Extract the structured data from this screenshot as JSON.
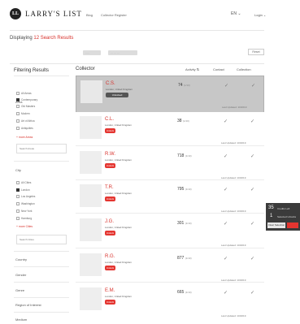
{
  "header": {
    "logo_mark": "LL",
    "logo_text": "LARRY'S LIST",
    "nav": [
      "Blog",
      "Collector Register"
    ],
    "lang": "EN",
    "login": "Login"
  },
  "results": {
    "prefix": "Displaying",
    "count_text": "12 Search Results"
  },
  "filters": {
    "pills": [
      "·····",
      "··· ··· ···"
    ],
    "reset_label": "Reset"
  },
  "sidebar": {
    "title": "Filtering Results",
    "area": {
      "head": "Area",
      "options": [
        {
          "label": "All Areas",
          "checked": false
        },
        {
          "label": "Contemporary",
          "checked": true
        },
        {
          "label": "Old Masters",
          "checked": false
        },
        {
          "label": "Modern",
          "checked": false
        },
        {
          "label": "Art of Africa",
          "checked": false
        },
        {
          "label": "Antiquities",
          "checked": false
        }
      ],
      "more": "+ more Areas",
      "input_placeholder": "Search Areas"
    },
    "city": {
      "head": "City",
      "options": [
        {
          "label": "All Cities",
          "checked": false
        },
        {
          "label": "London",
          "checked": true
        },
        {
          "label": "Los Angeles",
          "checked": false
        },
        {
          "label": "Washington",
          "checked": false
        },
        {
          "label": "New York",
          "checked": false
        },
        {
          "label": "Hamburg",
          "checked": false
        }
      ],
      "more": "+ more Cities",
      "input_placeholder": "Search Cities"
    },
    "sections": [
      "Country",
      "Gender",
      "Genre",
      "Region of Interest",
      "Medium"
    ]
  },
  "table": {
    "headers": {
      "collector": "Collector",
      "activity": "Activity",
      "col3": "Contact",
      "col4": "Collection"
    },
    "rows": [
      {
        "name": "C.S.",
        "location": "London, United Kingdom",
        "button": "Unlocked",
        "activity": "74",
        "activity_unit": "(1/10)",
        "updated": "Last Updated: 10/2019",
        "highlight": true
      },
      {
        "name": "C.L.",
        "location": "London, United Kingdom",
        "button": "Unlock",
        "activity": "38",
        "activity_unit": "(1/10)",
        "updated": "Last Updated: 10/2019",
        "highlight": false
      },
      {
        "name": "R.W.",
        "location": "London, United Kingdom",
        "button": "Unlock",
        "activity": "718",
        "activity_unit": "(1/10)",
        "updated": "Last Updated: 10/2019",
        "highlight": false
      },
      {
        "name": "T.R.",
        "location": "London, United Kingdom",
        "button": "Unlock",
        "activity": "795",
        "activity_unit": "(1/10)",
        "updated": "Last Updated: 10/2019",
        "highlight": false
      },
      {
        "name": "J.G.",
        "location": "London, United Kingdom",
        "button": "Unlock",
        "activity": "301",
        "activity_unit": "(1/10)",
        "updated": "Last Updated: 10/2019",
        "highlight": false
      },
      {
        "name": "R.G.",
        "location": "London, United Kingdom",
        "button": "Unlock",
        "activity": "877",
        "activity_unit": "(1/10)",
        "updated": "Last Updated: 10/2019",
        "highlight": false
      },
      {
        "name": "E.M.",
        "location": "London, United Kingdom",
        "button": "Unlock",
        "activity": "665",
        "activity_unit": "(1/10)",
        "updated": "Last Updated: 10/2019",
        "highlight": false
      }
    ],
    "check_glyph": "✓"
  },
  "widget": {
    "count_a": "35",
    "count_a_label": "Credits Left",
    "count_b": "1",
    "count_b_label": "Selected Unlocks",
    "button": "Clear Selection"
  },
  "colors": {
    "accent": "#d8312b",
    "highlight_row": "#c7c7c7"
  }
}
